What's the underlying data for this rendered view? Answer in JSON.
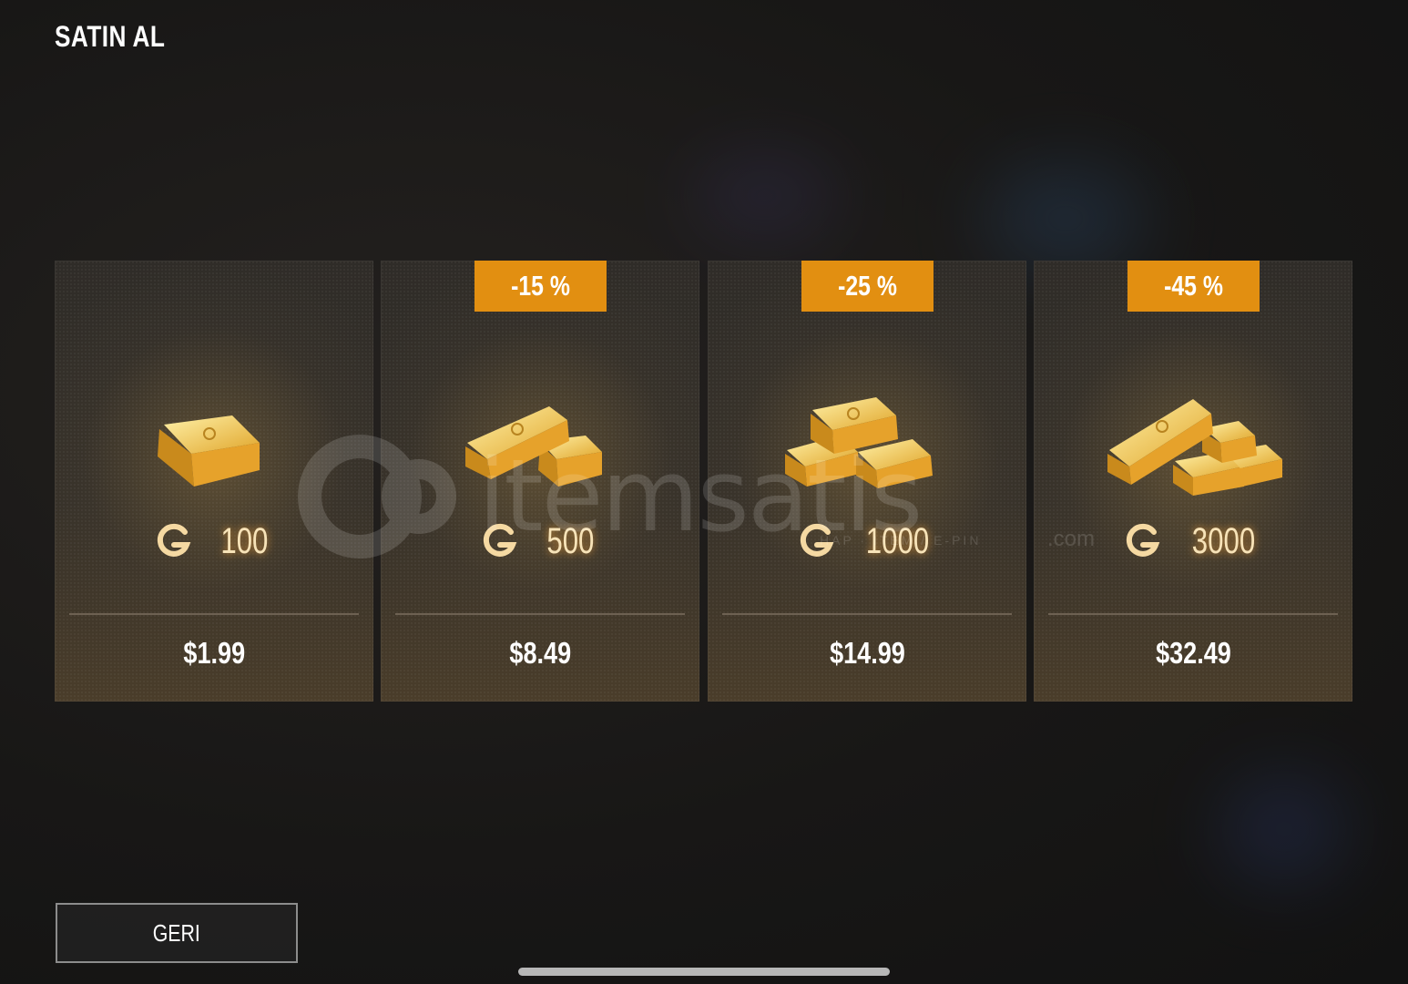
{
  "header": {
    "title": "SATIN AL"
  },
  "offers": [
    {
      "badge": "",
      "amount": "100",
      "price": "$1.99",
      "bars": 1
    },
    {
      "badge": "-15 %",
      "amount": "500",
      "price": "$8.49",
      "bars": 2
    },
    {
      "badge": "-25 %",
      "amount": "1000",
      "price": "$14.99",
      "bars": 4
    },
    {
      "badge": "-45 %",
      "amount": "3000",
      "price": "$32.49",
      "bars": 4
    }
  ],
  "footer": {
    "back_label": "GERI"
  },
  "watermark": {
    "brand": "itemsatis",
    "tagline": "HAP · ITEM / E-PIN",
    "domain": ".com"
  },
  "colors": {
    "badge": "#e28f11",
    "gold": "#e8b040",
    "background": "#181716"
  },
  "icons": {
    "currency": "gold-coin-g-icon"
  }
}
